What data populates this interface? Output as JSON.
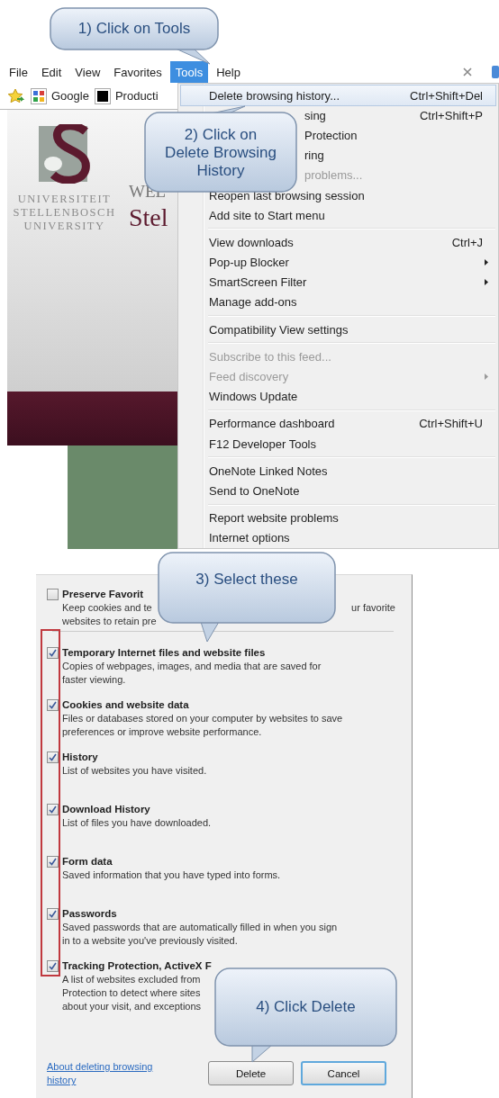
{
  "callouts": [
    {
      "text": "1) Click on Tools"
    },
    {
      "text": "2) Click on\nDelete Browsing\nHistory"
    },
    {
      "text": "3) Select these"
    },
    {
      "text": "4) Click Delete"
    }
  ],
  "menu_bar": [
    {
      "label": "File",
      "selected": false
    },
    {
      "label": "Edit",
      "selected": false
    },
    {
      "label": "View",
      "selected": false
    },
    {
      "label": "Favorites",
      "selected": false
    },
    {
      "label": "Tools",
      "selected": true
    },
    {
      "label": "Help",
      "selected": false
    }
  ],
  "favorites_bar": [
    {
      "label": "Google",
      "kind": "google"
    },
    {
      "label": "Producti",
      "kind": "dark"
    }
  ],
  "web_page": {
    "logo_lines": [
      "UNIVERSITEIT",
      "STELLENBOSCH",
      "UNIVERSITY"
    ],
    "heading_lines": [
      "WEL",
      "Stel"
    ]
  },
  "tools_menu": [
    [
      {
        "label": "Delete browsing history...",
        "shortcut": "Ctrl+Shift+Del",
        "kind": "item",
        "submenu": false,
        "disabled": false,
        "selected": true
      },
      {
        "label": "sing",
        "shortcut": "Ctrl+Shift+P",
        "kind": "fragment",
        "submenu": false,
        "disabled": false,
        "selected": false
      },
      {
        "label": "Protection",
        "kind": "fragment",
        "submenu": false,
        "disabled": false,
        "selected": false
      },
      {
        "label": "ring",
        "kind": "fragment",
        "submenu": false,
        "disabled": false,
        "selected": false
      },
      {
        "label": "problems...",
        "kind": "fragment",
        "submenu": false,
        "disabled": true,
        "selected": false
      },
      {
        "label": "Reopen last browsing session",
        "kind": "item",
        "submenu": false,
        "disabled": false,
        "selected": false
      },
      {
        "label": "Add site to Start menu",
        "kind": "item",
        "submenu": false,
        "disabled": false,
        "selected": false
      }
    ],
    [
      {
        "label": "View downloads",
        "shortcut": "Ctrl+J",
        "kind": "item",
        "submenu": false,
        "disabled": false,
        "selected": false
      },
      {
        "label": "Pop-up Blocker",
        "kind": "item",
        "submenu": true,
        "disabled": false,
        "selected": false
      },
      {
        "label": "SmartScreen Filter",
        "kind": "item",
        "submenu": true,
        "disabled": false,
        "selected": false
      },
      {
        "label": "Manage add-ons",
        "kind": "item",
        "submenu": false,
        "disabled": false,
        "selected": false
      }
    ],
    [
      {
        "label": "Compatibility View settings",
        "kind": "item",
        "submenu": false,
        "disabled": false,
        "selected": false
      }
    ],
    [
      {
        "label": "Subscribe to this feed...",
        "kind": "item",
        "submenu": false,
        "disabled": true,
        "selected": false
      },
      {
        "label": "Feed discovery",
        "kind": "item",
        "submenu": true,
        "disabled": true,
        "selected": false
      },
      {
        "label": "Windows Update",
        "kind": "item",
        "submenu": false,
        "disabled": false,
        "selected": false
      }
    ],
    [
      {
        "label": "Performance dashboard",
        "shortcut": "Ctrl+Shift+U",
        "kind": "item",
        "submenu": false,
        "disabled": false,
        "selected": false
      },
      {
        "label": "F12 Developer Tools",
        "kind": "item",
        "submenu": false,
        "disabled": false,
        "selected": false
      }
    ],
    [
      {
        "label": "OneNote Linked Notes",
        "kind": "item",
        "submenu": false,
        "disabled": false,
        "selected": false
      },
      {
        "label": "Send to OneNote",
        "kind": "item",
        "submenu": false,
        "disabled": false,
        "selected": false
      }
    ],
    [
      {
        "label": "Report website problems",
        "kind": "item",
        "submenu": false,
        "disabled": false,
        "selected": false
      },
      {
        "label": "Internet options",
        "kind": "item",
        "submenu": false,
        "disabled": false,
        "selected": false
      }
    ]
  ],
  "dialog": {
    "options": [
      {
        "title": "Preserve Favorit",
        "description_lines": [
          "Keep cookies and te",
          "websites to retain pre"
        ],
        "right_fragment": "ur favorite",
        "checked": false
      },
      {
        "title": "Temporary Internet files and website files",
        "description_lines": [
          "Copies of webpages, images, and media that are saved for",
          "faster viewing."
        ],
        "checked": true
      },
      {
        "title": "Cookies and website data",
        "description_lines": [
          "Files or databases stored on your computer by websites to save",
          "preferences or improve website performance."
        ],
        "checked": true
      },
      {
        "title": "History",
        "description_lines": [
          "List of websites you have visited."
        ],
        "checked": true
      },
      {
        "title": "Download History",
        "description_lines": [
          "List of files you have downloaded."
        ],
        "checked": true
      },
      {
        "title": "Form data",
        "description_lines": [
          "Saved information that you have typed into forms."
        ],
        "checked": true
      },
      {
        "title": "Passwords",
        "description_lines": [
          "Saved passwords that are automatically filled in when you sign",
          "in to a website you've previously visited."
        ],
        "checked": true
      },
      {
        "title": "Tracking Protection, ActiveX F",
        "description_lines": [
          "A list of websites excluded from",
          "Protection to detect where sites",
          "about your visit, and exceptions"
        ],
        "checked": true
      }
    ],
    "link": "About deleting browsing history",
    "buttons": [
      {
        "label": "Delete",
        "focused": false
      },
      {
        "label": "Cancel",
        "focused": true
      }
    ]
  }
}
